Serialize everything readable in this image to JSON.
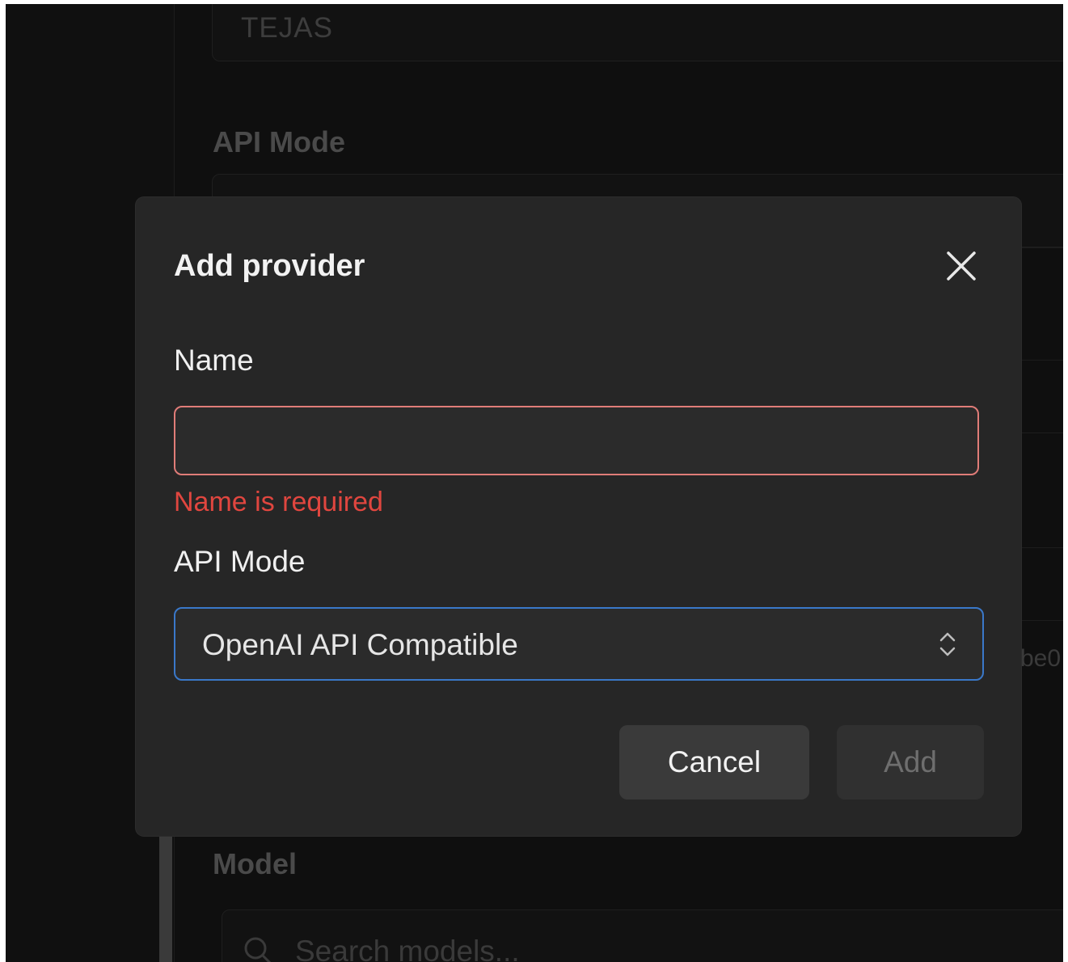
{
  "background": {
    "top_field_value": "TEJAS",
    "api_mode_label": "API Mode",
    "model_label": "Model",
    "peek_text": "be0",
    "search_placeholder": "Search models..."
  },
  "modal": {
    "title": "Add provider",
    "name_label": "Name",
    "name_value": "",
    "name_error": "Name is required",
    "api_mode_label": "API Mode",
    "api_mode_value": "OpenAI API Compatible",
    "cancel_label": "Cancel",
    "add_label": "Add"
  },
  "colors": {
    "error": "#e0463f",
    "error_border": "#e07c78",
    "focus_border": "#3a78c9",
    "modal_bg": "#262626"
  },
  "icons": {
    "close": "close-icon",
    "select": "chevron-up-down-icon",
    "search": "search-icon"
  }
}
